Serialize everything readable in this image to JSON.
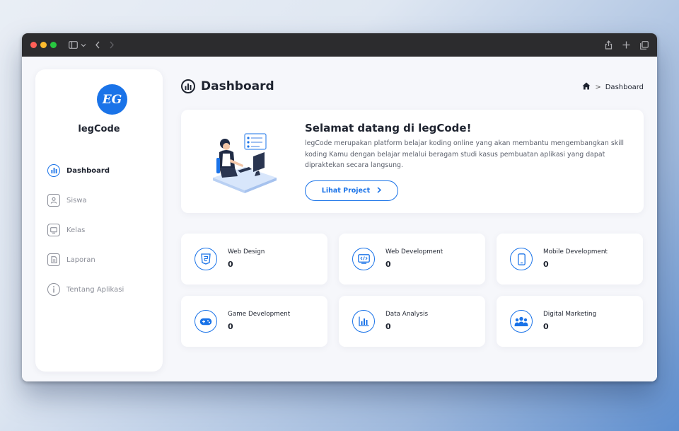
{
  "browser": {
    "buttons": [
      "close",
      "minimize",
      "zoom"
    ]
  },
  "sidebar": {
    "logo_text": "EG",
    "brand": "legCode",
    "items": [
      {
        "label": "Dashboard",
        "icon": "chart-icon",
        "active": true
      },
      {
        "label": "Siswa",
        "icon": "user-icon",
        "active": false
      },
      {
        "label": "Kelas",
        "icon": "monitor-icon",
        "active": false
      },
      {
        "label": "Laporan",
        "icon": "document-icon",
        "active": false
      },
      {
        "label": "Tentang Aplikasi",
        "icon": "info-icon",
        "active": false
      }
    ]
  },
  "header": {
    "title": "Dashboard",
    "breadcrumb": {
      "current": "Dashboard",
      "separator": ">"
    }
  },
  "welcome": {
    "title_prefix": "Selamat datang di ",
    "title_brand": "legCode",
    "title_suffix": "!",
    "description": "legCode merupakan platform belajar koding online yang akan membantu mengembangkan skill koding Kamu dengan belajar melalui beragam studi kasus pembuatan aplikasi yang dapat dipraktekan secara langsung.",
    "button_label": "Lihat Project"
  },
  "cards": [
    {
      "label": "Web Design",
      "value": "0",
      "icon": "html5-icon"
    },
    {
      "label": "Web Development",
      "value": "0",
      "icon": "code-window-icon"
    },
    {
      "label": "Mobile Development",
      "value": "0",
      "icon": "mobile-icon"
    },
    {
      "label": "Game Development",
      "value": "0",
      "icon": "gamepad-icon"
    },
    {
      "label": "Data Analysis",
      "value": "0",
      "icon": "bar-chart-icon"
    },
    {
      "label": "Digital Marketing",
      "value": "0",
      "icon": "people-icon"
    }
  ],
  "colors": {
    "accent": "#1a73e8",
    "text": "#1f2430",
    "muted": "#8c8f99",
    "background": "#f6f7fb"
  }
}
